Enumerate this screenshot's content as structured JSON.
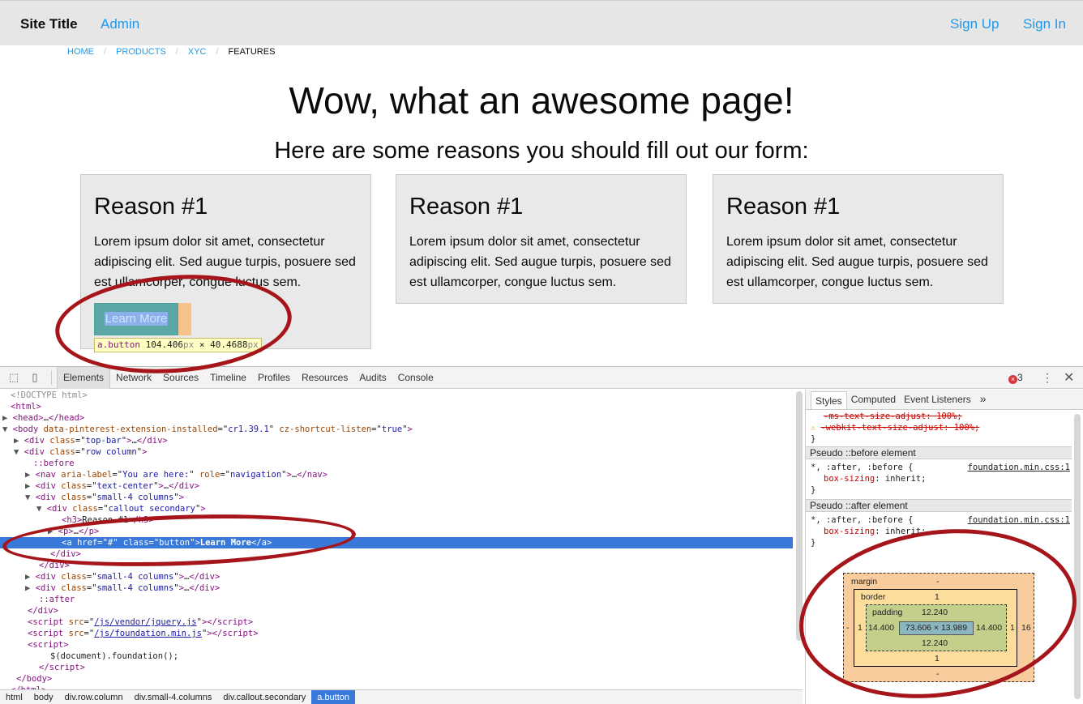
{
  "header": {
    "site_title": "Site Title",
    "admin": "Admin",
    "sign_up": "Sign Up",
    "sign_in": "Sign In"
  },
  "breadcrumbs": [
    "HOME",
    "PRODUCTS",
    "XYC",
    "FEATURES"
  ],
  "breadcrumb_separator": "/",
  "hero": {
    "title": "Wow, what an awesome page!",
    "subtitle": "Here are some reasons you should fill out our form:"
  },
  "callouts": [
    {
      "title": "Reason #1",
      "text": "Lorem ipsum dolor sit amet, consectetur adipiscing elit. Sed augue turpis, posuere sed est ullamcorper, congue luctus sem."
    },
    {
      "title": "Reason #1",
      "text": "Lorem ipsum dolor sit amet, consectetur adipiscing elit. Sed augue turpis, posuere sed est ullamcorper, congue luctus sem."
    },
    {
      "title": "Reason #1",
      "text": "Lorem ipsum dolor sit amet, consectetur adipiscing elit. Sed augue turpis, posuere sed est ullamcorper, congue luctus sem."
    }
  ],
  "learn_more": "Learn More",
  "inspect_tooltip": {
    "selector": "a.button",
    "width": "104.406",
    "height": "40.4688",
    "unit": "px",
    "times": "×"
  },
  "devtools": {
    "tabs": [
      "Elements",
      "Network",
      "Sources",
      "Timeline",
      "Profiles",
      "Resources",
      "Audits",
      "Console"
    ],
    "active_tab": "Elements",
    "error_count": "3",
    "error_icon": "×",
    "menu_icon": "⋮",
    "close_icon": "✕",
    "inspect_icon": "⬚",
    "device_icon": "▯",
    "dom_lines": [
      {
        "indent": 1,
        "tri": "",
        "html": "<span class=\"comment\">&lt;!DOCTYPE html&gt;</span>"
      },
      {
        "indent": 1,
        "tri": "",
        "html": "<span class=\"tag-n\">&lt;html&gt;</span>"
      },
      {
        "indent": 1,
        "tri": "▶",
        "html": "<span class=\"tag-n\">&lt;head&gt;</span>…<span class=\"tag-n\">&lt;/head&gt;</span>"
      },
      {
        "indent": 1,
        "tri": "▼",
        "html": "<span class=\"tag-n\">&lt;body </span><span class=\"attr-n\">data-pinterest-extension-installed</span>=\"<span class=\"attr-v\">cr1.39.1</span>\" <span class=\"attr-n\">cz-shortcut-listen</span>=\"<span class=\"attr-v\">true</span>\"<span class=\"tag-n\">&gt;</span>"
      },
      {
        "indent": 3,
        "tri": "▶",
        "html": "<span class=\"tag-n\">&lt;div </span><span class=\"attr-n\">class</span>=\"<span class=\"attr-v\">top-bar</span>\"<span class=\"tag-n\">&gt;</span>…<span class=\"tag-n\">&lt;/div&gt;</span>"
      },
      {
        "indent": 3,
        "tri": "▼",
        "html": "<span class=\"tag-n\">&lt;div </span><span class=\"attr-n\">class</span>=\"<span class=\"attr-v\">row column</span>\"<span class=\"tag-n\">&gt;</span>"
      },
      {
        "indent": 5,
        "tri": "",
        "html": "<span class=\"pseudo\">::before</span>"
      },
      {
        "indent": 5,
        "tri": "▶",
        "html": "<span class=\"tag-n\">&lt;nav </span><span class=\"attr-n\">aria-label</span>=\"<span class=\"attr-v\">You are here:</span>\" <span class=\"attr-n\">role</span>=\"<span class=\"attr-v\">navigation</span>\"<span class=\"tag-n\">&gt;</span>…<span class=\"tag-n\">&lt;/nav&gt;</span>"
      },
      {
        "indent": 5,
        "tri": "▶",
        "html": "<span class=\"tag-n\">&lt;div </span><span class=\"attr-n\">class</span>=\"<span class=\"attr-v\">text-center</span>\"<span class=\"tag-n\">&gt;</span>…<span class=\"tag-n\">&lt;/div&gt;</span>"
      },
      {
        "indent": 5,
        "tri": "▼",
        "html": "<span class=\"tag-n\">&lt;div </span><span class=\"attr-n\">class</span>=\"<span class=\"attr-v\">small-4 columns</span>\"<span class=\"tag-n\">&gt;</span>"
      },
      {
        "indent": 7,
        "tri": "▼",
        "html": "<span class=\"tag-n\">&lt;div </span><span class=\"attr-n\">class</span>=\"<span class=\"attr-v\">callout secondary</span>\"<span class=\"tag-n\">&gt;</span>"
      },
      {
        "indent": 10,
        "tri": "",
        "html": "<span class=\"tag-n\">&lt;h3&gt;</span>Reason #1<span class=\"tag-n\">&lt;/h3&gt;</span>"
      },
      {
        "indent": 9,
        "tri": "▶",
        "html": "<span class=\"tag-n\">&lt;p&gt;</span>…<span class=\"tag-n\">&lt;/p&gt;</span>"
      },
      {
        "indent": 10,
        "tri": "",
        "selected": true,
        "html": "<span class=\"tag-n\">&lt;a </span><span class=\"attr-n\">href</span>=\"<span class=\"attr-v\">#</span>\" <span class=\"attr-n\">class</span>=\"<span class=\"attr-v\">button</span>\"<span class=\"tag-n\">&gt;</span><b>Learn More</b><span class=\"tag-n\">&lt;/a&gt;</span>"
      },
      {
        "indent": 8,
        "tri": "",
        "html": "<span class=\"tag-n\">&lt;/div&gt;</span>"
      },
      {
        "indent": 6,
        "tri": "",
        "html": "<span class=\"tag-n\">&lt;/div&gt;</span>"
      },
      {
        "indent": 5,
        "tri": "▶",
        "html": "<span class=\"tag-n\">&lt;div </span><span class=\"attr-n\">class</span>=\"<span class=\"attr-v\">small-4 columns</span>\"<span class=\"tag-n\">&gt;</span>…<span class=\"tag-n\">&lt;/div&gt;</span>"
      },
      {
        "indent": 5,
        "tri": "▶",
        "html": "<span class=\"tag-n\">&lt;div </span><span class=\"attr-n\">class</span>=\"<span class=\"attr-v\">small-4 columns</span>\"<span class=\"tag-n\">&gt;</span>…<span class=\"tag-n\">&lt;/div&gt;</span>"
      },
      {
        "indent": 6,
        "tri": "",
        "html": "<span class=\"pseudo\">::after</span>"
      },
      {
        "indent": 4,
        "tri": "",
        "html": "<span class=\"tag-n\">&lt;/div&gt;</span>"
      },
      {
        "indent": 4,
        "tri": "",
        "html": "<span class=\"tag-n\">&lt;script </span><span class=\"attr-n\">src</span>=\"<span class=\"attr-link\">/js/vendor/jquery.js</span>\"<span class=\"tag-n\">&gt;&lt;/script&gt;</span>"
      },
      {
        "indent": 4,
        "tri": "",
        "html": "<span class=\"tag-n\">&lt;script </span><span class=\"attr-n\">src</span>=\"<span class=\"attr-link\">/js/foundation.min.js</span>\"<span class=\"tag-n\">&gt;&lt;/script&gt;</span>"
      },
      {
        "indent": 4,
        "tri": "",
        "html": "<span class=\"tag-n\">&lt;script&gt;</span>"
      },
      {
        "indent": 8,
        "tri": "",
        "html": "$(document).foundation();"
      },
      {
        "indent": 6,
        "tri": "",
        "html": "<span class=\"tag-n\">&lt;/script&gt;</span>"
      },
      {
        "indent": 2,
        "tri": "",
        "html": "<span class=\"tag-n\">&lt;/body&gt;</span>"
      },
      {
        "indent": 1,
        "tri": "",
        "html": "<span class=\"tag-n\">&lt;/html&gt;</span>"
      }
    ],
    "dom_breadcrumbs": [
      "html",
      "body",
      "div.row.column",
      "div.small-4.columns",
      "div.callout.secondary",
      "a.button"
    ],
    "styles_tabs": [
      "Styles",
      "Computed",
      "Event Listeners"
    ],
    "styles_more": "»",
    "styles": {
      "ms_text_size": "-ms-text-size-adjust: 100%;",
      "webkit_text_size": "-webkit-text-size-adjust: 100%;",
      "close_brace": "}",
      "warn_icon": "⚠",
      "before_header": "Pseudo ::before element",
      "after_header": "Pseudo ::after element",
      "rule_selector": "*, :after, :before {",
      "rule_decl": "box-sizing: inherit;",
      "rule_prop": "box-sizing",
      "rule_val": ": inherit;",
      "source": "foundation.min.css:1"
    },
    "box_model": {
      "margin_label": "margin",
      "margin_top": "-",
      "margin_bottom": "-",
      "margin_left": "-",
      "margin_right": "16",
      "border_label": "border",
      "border_top": "1",
      "border_bottom": "1",
      "border_left": "1",
      "border_right": "1",
      "padding_label": "padding",
      "padding_top": "12.240",
      "padding_bottom": "12.240",
      "padding_left": "14.400",
      "padding_right": "14.400",
      "content": "73.606 × 13.989"
    }
  }
}
